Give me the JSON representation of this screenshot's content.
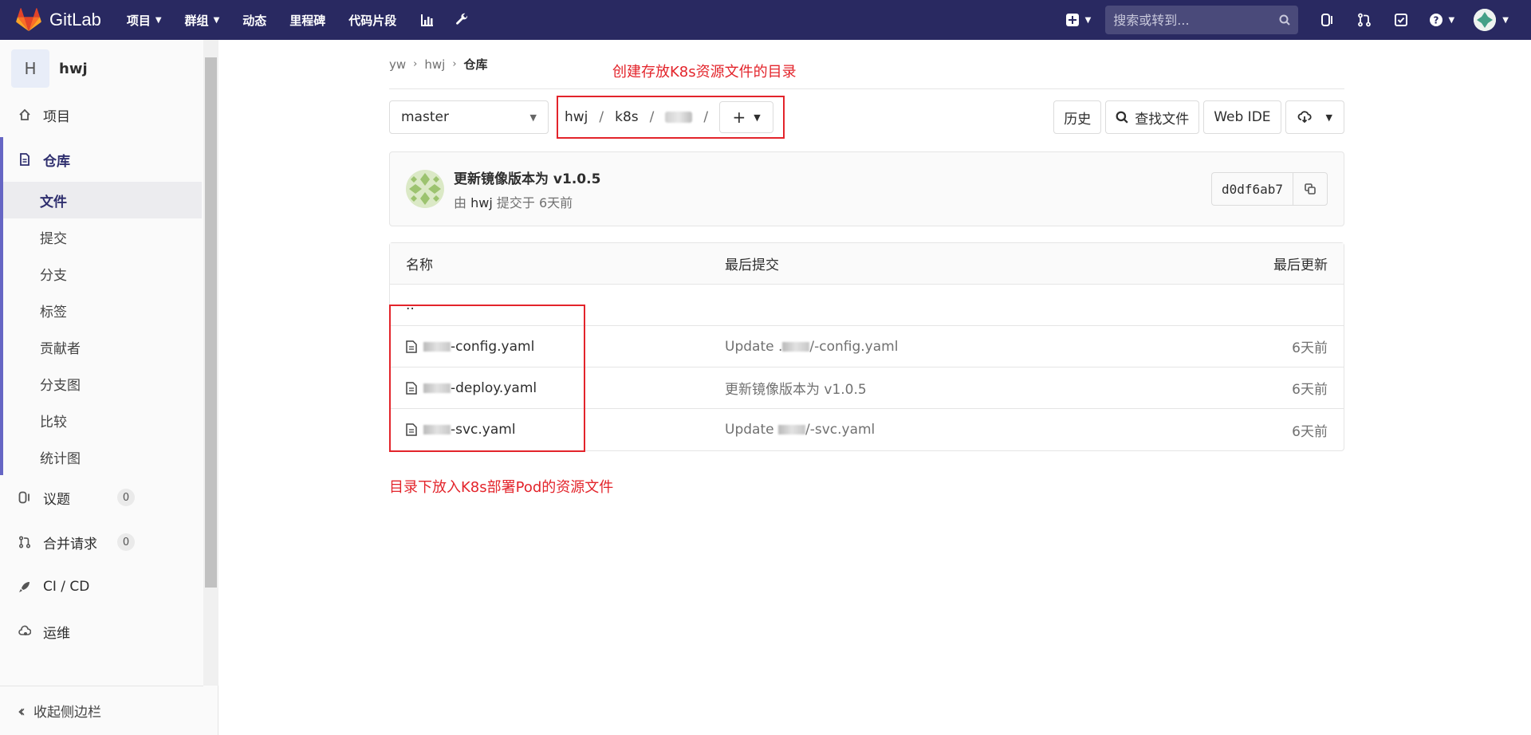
{
  "navbar": {
    "brand": "GitLab",
    "links": [
      {
        "label": "项目",
        "has_caret": true
      },
      {
        "label": "群组",
        "has_caret": true
      },
      {
        "label": "动态",
        "has_caret": false
      },
      {
        "label": "里程碑",
        "has_caret": false
      },
      {
        "label": "代码片段",
        "has_caret": false
      }
    ],
    "search_placeholder": "搜索或转到..."
  },
  "sidebar": {
    "context_initial": "H",
    "context_name": "hwj",
    "project_label": "项目",
    "repo_label": "仓库",
    "repo_items": [
      "文件",
      "提交",
      "分支",
      "标签",
      "贡献者",
      "分支图",
      "比较",
      "统计图"
    ],
    "issues_label": "议题",
    "issues_count": "0",
    "mr_label": "合并请求",
    "mr_count": "0",
    "cicd_label": "CI / CD",
    "ops_label": "运维",
    "collapse_label": "收起侧边栏"
  },
  "breadcrumb": {
    "items": [
      "yw",
      "hwj"
    ],
    "current": "仓库"
  },
  "annotations": {
    "top": "创建存放K8s资源文件的目录",
    "bottom": "目录下放入K8s部署Pod的资源文件"
  },
  "tree": {
    "branch": "master",
    "path": [
      "hwj",
      "k8s"
    ],
    "history_label": "历史",
    "find_file_label": "查找文件",
    "web_ide_label": "Web IDE"
  },
  "commit": {
    "title": "更新镜像版本为 v1.0.5",
    "by": "由",
    "author": "hwj",
    "submitted": "提交于",
    "time": "6天前",
    "sha": "d0df6ab7"
  },
  "files": {
    "headers": {
      "name": "名称",
      "last_commit": "最后提交",
      "last_update": "最后更新"
    },
    "parent": "..",
    "rows": [
      {
        "name": "-config.yaml",
        "commit_prefix": "Update .",
        "commit_suffix": "/-config.yaml",
        "date": "6天前"
      },
      {
        "name": "-deploy.yaml",
        "commit_prefix": "更新镜像版本为 v1.0.5",
        "commit_suffix": "",
        "date": "6天前"
      },
      {
        "name": "-svc.yaml",
        "commit_prefix": "Update ",
        "commit_suffix": "/-svc.yaml",
        "date": "6天前"
      }
    ]
  },
  "colors": {
    "navbar": "#292961",
    "annotation": "#e3242b",
    "active_bar": "#6666c4"
  }
}
